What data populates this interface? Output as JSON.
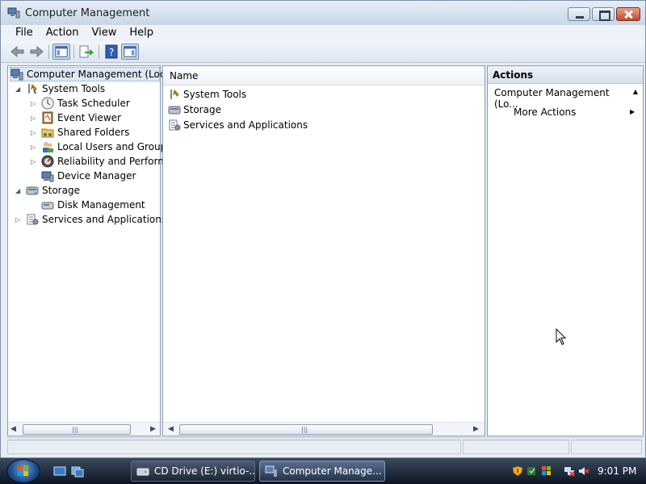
{
  "window": {
    "title": "Computer Management"
  },
  "menu": [
    "File",
    "Action",
    "View",
    "Help"
  ],
  "tree": {
    "root": "Computer Management (Local",
    "system_tools": "System Tools",
    "task_scheduler": "Task Scheduler",
    "event_viewer": "Event Viewer",
    "shared_folders": "Shared Folders",
    "local_users": "Local Users and Groups",
    "reliability": "Reliability and Performa",
    "device_manager": "Device Manager",
    "storage": "Storage",
    "disk_management": "Disk Management",
    "services": "Services and Applications"
  },
  "list": {
    "column": "Name",
    "items": [
      "System Tools",
      "Storage",
      "Services and Applications"
    ]
  },
  "actions": {
    "header": "Actions",
    "section": "Computer Management (Lo...",
    "more": "More Actions"
  },
  "taskbar": {
    "tasks": [
      "CD Drive (E:) virtio-...",
      "Computer Manage..."
    ],
    "clock": "9:01 PM"
  },
  "colors": {
    "accent": "#1e4e8a",
    "selection": "#dce9f7"
  }
}
